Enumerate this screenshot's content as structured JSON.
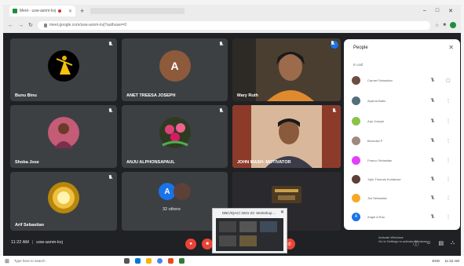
{
  "browser": {
    "tab_title": "Meet - usw-asnm-kvj",
    "url": "meet.google.com/usw-asnm-kvj?authuser=0",
    "new_tab": "+",
    "window_controls": [
      "–",
      "□",
      "✕"
    ]
  },
  "tiles": [
    {
      "id": "tile-bunu",
      "name": "Bunu Binu",
      "avatar_color": "#000000",
      "type": "photo"
    },
    {
      "id": "tile-anet",
      "name": "ANET TREESA JOSEPH",
      "avatar_letter": "A",
      "avatar_color": "#8d5a3b",
      "type": "letter"
    },
    {
      "id": "tile-mary",
      "name": "Mary Ruth",
      "type": "video"
    },
    {
      "id": "tile-shoba",
      "name": "Shoba Jose",
      "avatar_color": "#c45b77",
      "type": "photo"
    },
    {
      "id": "tile-anju",
      "name": "ANJU ALPHONSAPAUL",
      "avatar_color": "#b03060",
      "type": "photo"
    },
    {
      "id": "tile-john",
      "name": "JOHN MASH: MOTIVATOR",
      "type": "video"
    },
    {
      "id": "tile-arif",
      "name": "Arif Sebastian",
      "avatar_color": "#b8860b",
      "type": "photo"
    },
    {
      "id": "tile-others",
      "name": "32 others",
      "avatar_letter": "A",
      "avatar_color": "#1a73e8",
      "type": "others"
    },
    {
      "id": "tile-present",
      "name": "",
      "type": "presentation"
    }
  ],
  "people_panel": {
    "title": "People",
    "close": "✕",
    "section": "In call",
    "members": [
      {
        "name": "Carmel Sebastian",
        "color": "#6d4c41"
      },
      {
        "name": "Aparna Babu",
        "color": "#546e7a"
      },
      {
        "name": "Arju Joseph",
        "color": "#8bc34a"
      },
      {
        "name": "Benedict P",
        "color": "#a1887f"
      },
      {
        "name": "Franco Sebastian",
        "color": "#e040fb"
      },
      {
        "name": "Jojin Thomas Kuriakose",
        "color": "#5d4037"
      },
      {
        "name": "Jini Sebastian",
        "color": "#f9a825"
      },
      {
        "name": "Angel A Rao",
        "color": "#1a73e8",
        "letter": "A"
      }
    ]
  },
  "bottom_bar": {
    "time": "11:22 AM",
    "meeting_code": "usw-asnm-kvj",
    "activate_line1": "Activate Windows",
    "activate_line2": "Go to Settings to activate Windows."
  },
  "preview": {
    "title": "DBC/IQAC/ 2021-22: Workshop ...",
    "close": "✕"
  },
  "taskbar": {
    "search_placeholder": "Type here to search",
    "tray_lang": "ENG",
    "tray_time": "11:22 AM"
  },
  "colors": {
    "meet_bg": "#202124",
    "tile_bg": "#3c4043",
    "end_call": "#ea4335"
  }
}
